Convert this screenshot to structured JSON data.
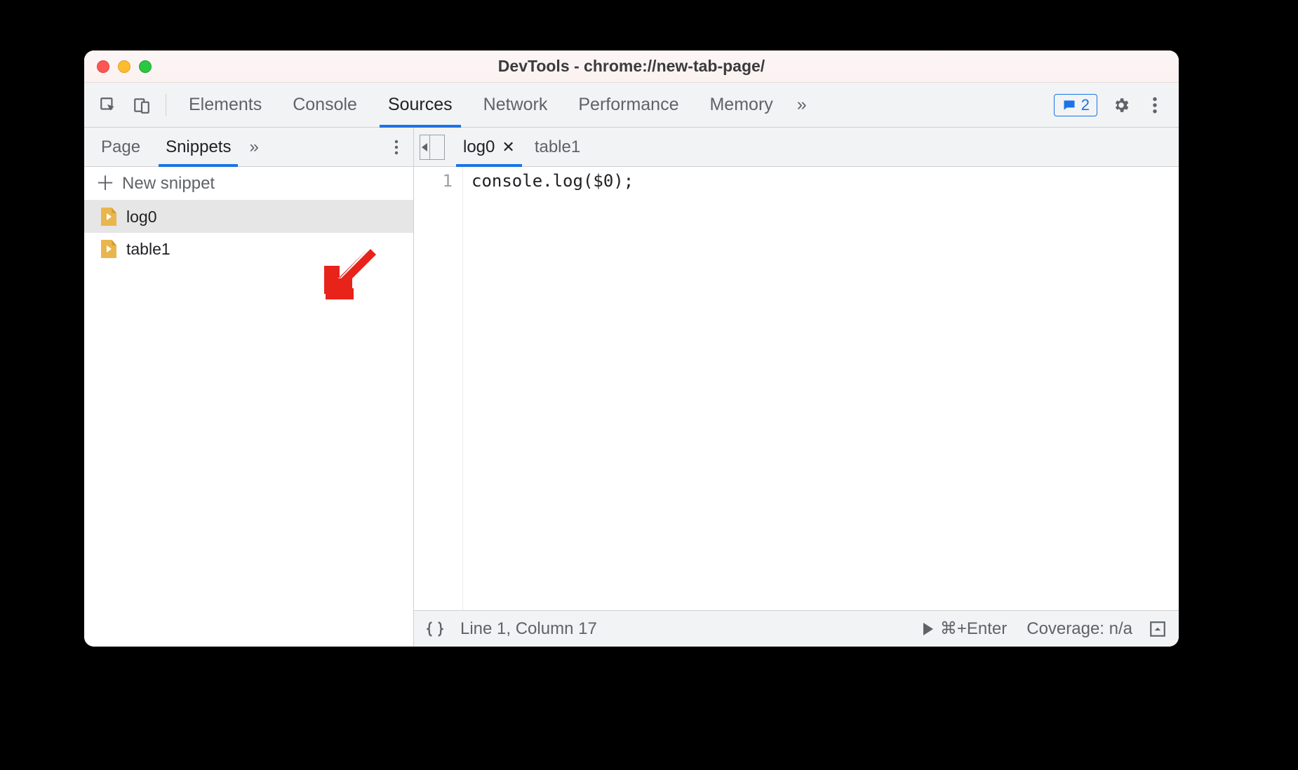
{
  "window": {
    "title": "DevTools - chrome://new-tab-page/"
  },
  "toolbar": {
    "tabs": [
      "Elements",
      "Console",
      "Sources",
      "Network",
      "Performance",
      "Memory"
    ],
    "active_tab": "Sources",
    "message_count": "2"
  },
  "sidebar": {
    "tabs": [
      "Page",
      "Snippets"
    ],
    "active_tab": "Snippets",
    "new_snippet_label": "New snippet",
    "snippets": [
      {
        "name": "log0",
        "selected": true
      },
      {
        "name": "table1",
        "selected": false
      }
    ]
  },
  "editor": {
    "tabs": [
      {
        "name": "log0",
        "active": true,
        "closable": true
      },
      {
        "name": "table1",
        "active": false,
        "closable": false
      }
    ],
    "line_number": "1",
    "code": "console.log($0);"
  },
  "statusbar": {
    "cursor": "Line 1, Column 17",
    "run_hint": "⌘+Enter",
    "coverage": "Coverage: n/a"
  }
}
